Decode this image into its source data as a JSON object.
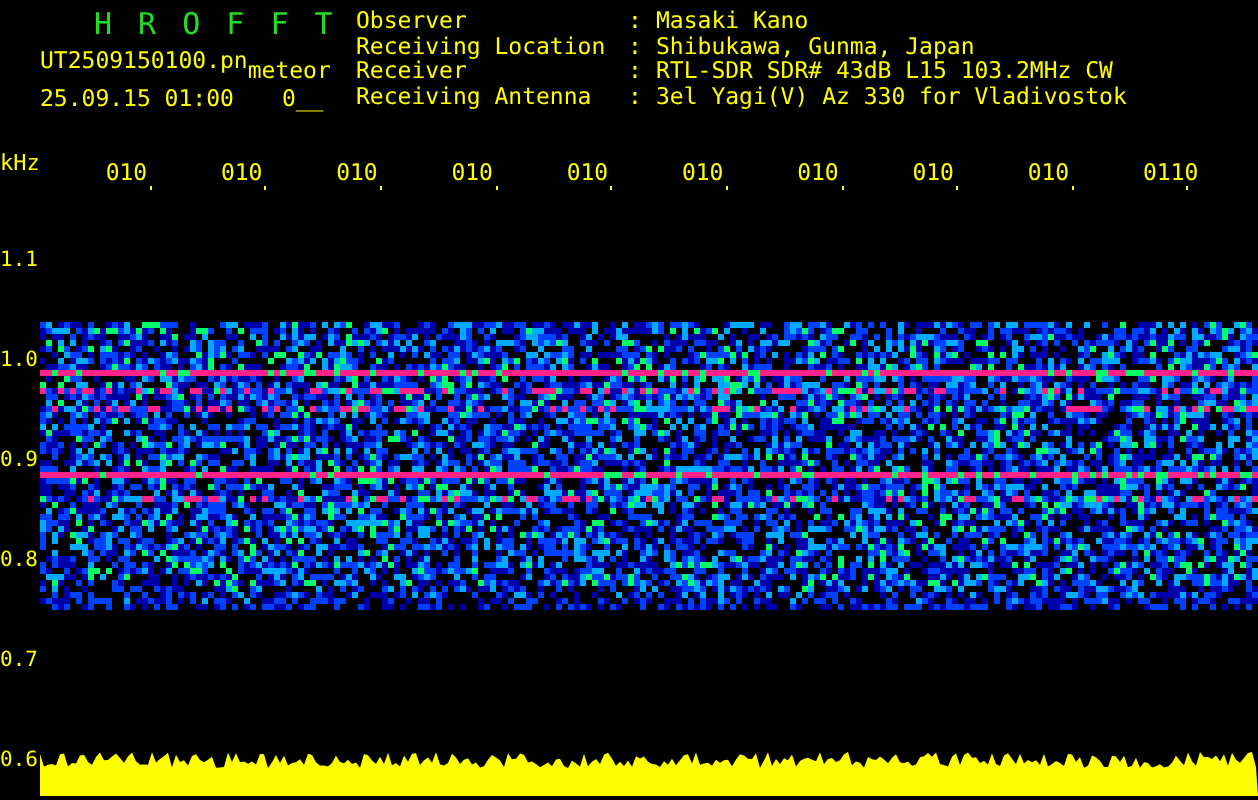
{
  "title": "H R O F F T",
  "file": {
    "name": "UT2509150100.pn",
    "tag": "meteor",
    "datetime": "25.09.15 01:00",
    "count": "0__"
  },
  "info": [
    {
      "label": "Observer",
      "separator": ":",
      "value": "Masaki Kano"
    },
    {
      "label": "Receiving Location",
      "separator": ":",
      "value": "Shibukawa, Gunma, Japan"
    },
    {
      "label": "Receiver",
      "separator": ":",
      "value": "RTL-SDR SDR# 43dB L15 103.2MHz CW"
    },
    {
      "label": "Receiving Antenna",
      "separator": ":",
      "value": "3el Yagi(V) Az 330 for Vladivostok"
    }
  ],
  "y_unit": "kHz",
  "x_ticks": [
    "010",
    "010",
    "010",
    "010",
    "010",
    "010",
    "010",
    "010",
    "010",
    "0110"
  ],
  "y_ticks": [
    "1.1",
    "1.0",
    "0.9",
    "0.8",
    "0.7",
    "0.6"
  ]
}
